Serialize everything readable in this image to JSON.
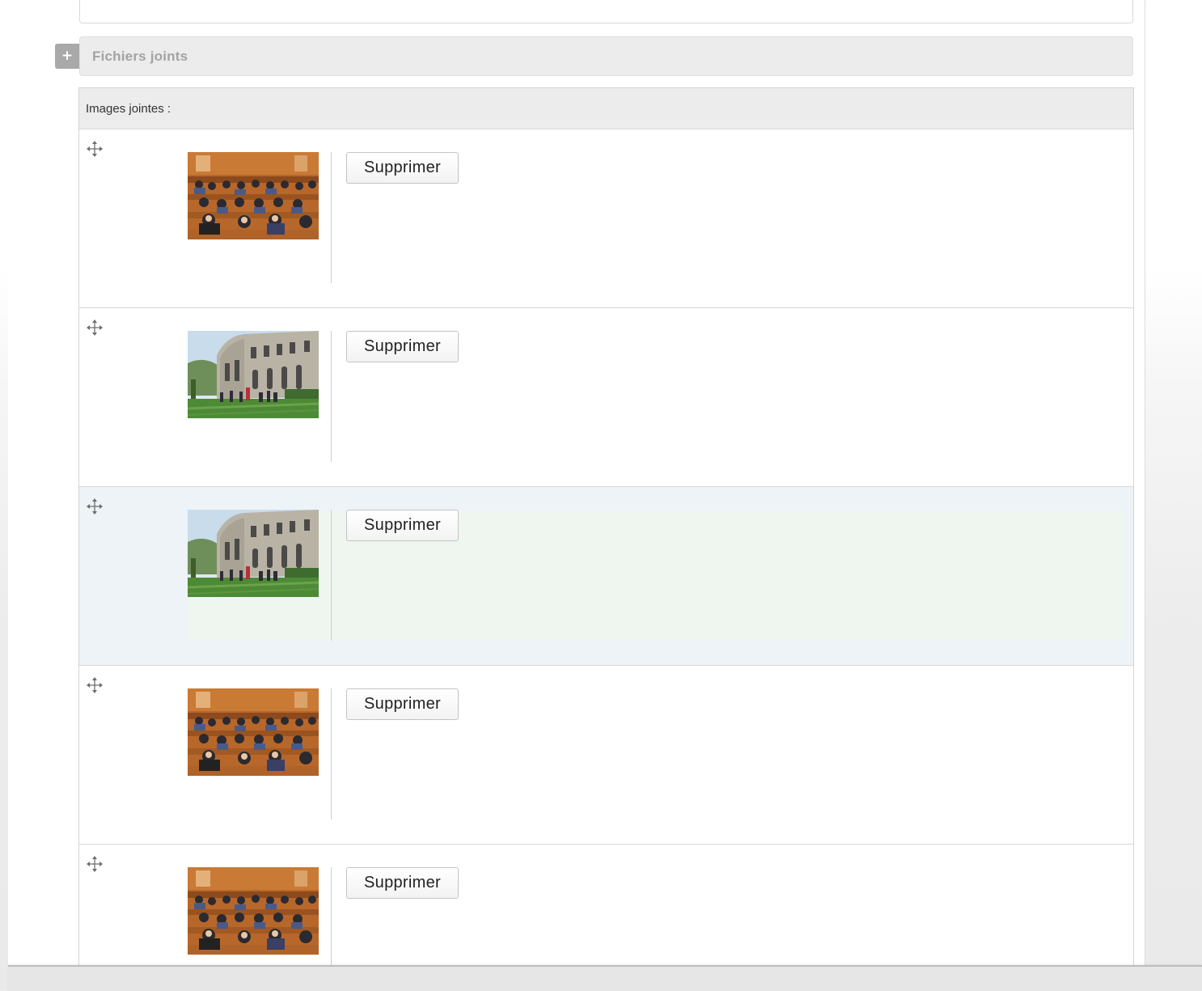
{
  "attachments_section": {
    "title": "Fichiers joints",
    "toggle_symbol": "+"
  },
  "images_panel": {
    "header_label": "Images jointes :",
    "drag_icon": "move-arrows-icon",
    "items": [
      {
        "thumbnail": "lecture-hall-audience-photo",
        "delete_label": "Supprimer",
        "selected": false
      },
      {
        "thumbnail": "building-exterior-lawn-photo",
        "delete_label": "Supprimer",
        "selected": false
      },
      {
        "thumbnail": "building-exterior-lawn-photo",
        "delete_label": "Supprimer",
        "selected": true
      },
      {
        "thumbnail": "lecture-hall-audience-photo",
        "delete_label": "Supprimer",
        "selected": false
      },
      {
        "thumbnail": "lecture-hall-audience-photo",
        "delete_label": "Supprimer",
        "selected": false
      }
    ]
  }
}
